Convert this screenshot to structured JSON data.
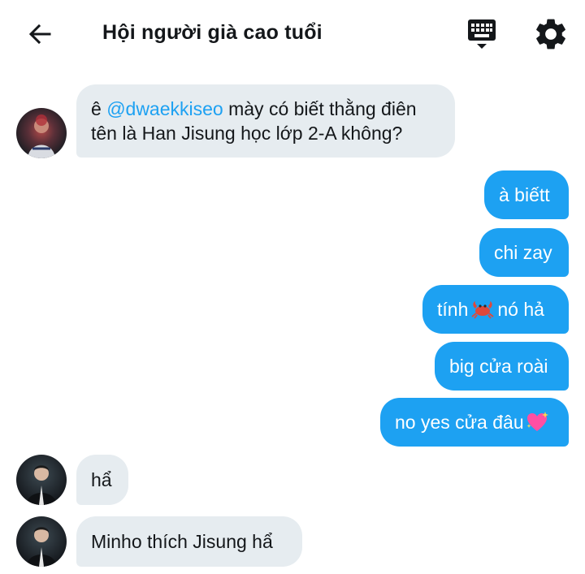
{
  "header": {
    "title": "Hội người già cao tuổi",
    "back_icon": "arrow-left-icon",
    "keyboard_icon": "keyboard-icon",
    "settings_icon": "gear-icon"
  },
  "colors": {
    "accent": "#1da1f2",
    "incoming_bubble": "#e6ecf0",
    "text": "#14171a"
  },
  "messages": [
    {
      "direction": "in",
      "prefix": "ê ",
      "mention": "@dwaekkiseo",
      "line1_rest": " mày có biết thằng điên",
      "line2": "tên là Han Jisung học lớp 2-A không?"
    },
    {
      "direction": "out",
      "text": "à biếtt"
    },
    {
      "direction": "out",
      "text": "chi zay"
    },
    {
      "direction": "out",
      "text_before": "tính",
      "emoji": "crab-emoji",
      "text_after": "nó hả"
    },
    {
      "direction": "out",
      "text": "big cửa roài"
    },
    {
      "direction": "out",
      "text": "no yes cửa đâu",
      "emoji": "sparkling-heart-emoji"
    },
    {
      "direction": "in",
      "text": "hẩ"
    },
    {
      "direction": "in",
      "text": "Minho thích Jisung hẩ"
    }
  ]
}
